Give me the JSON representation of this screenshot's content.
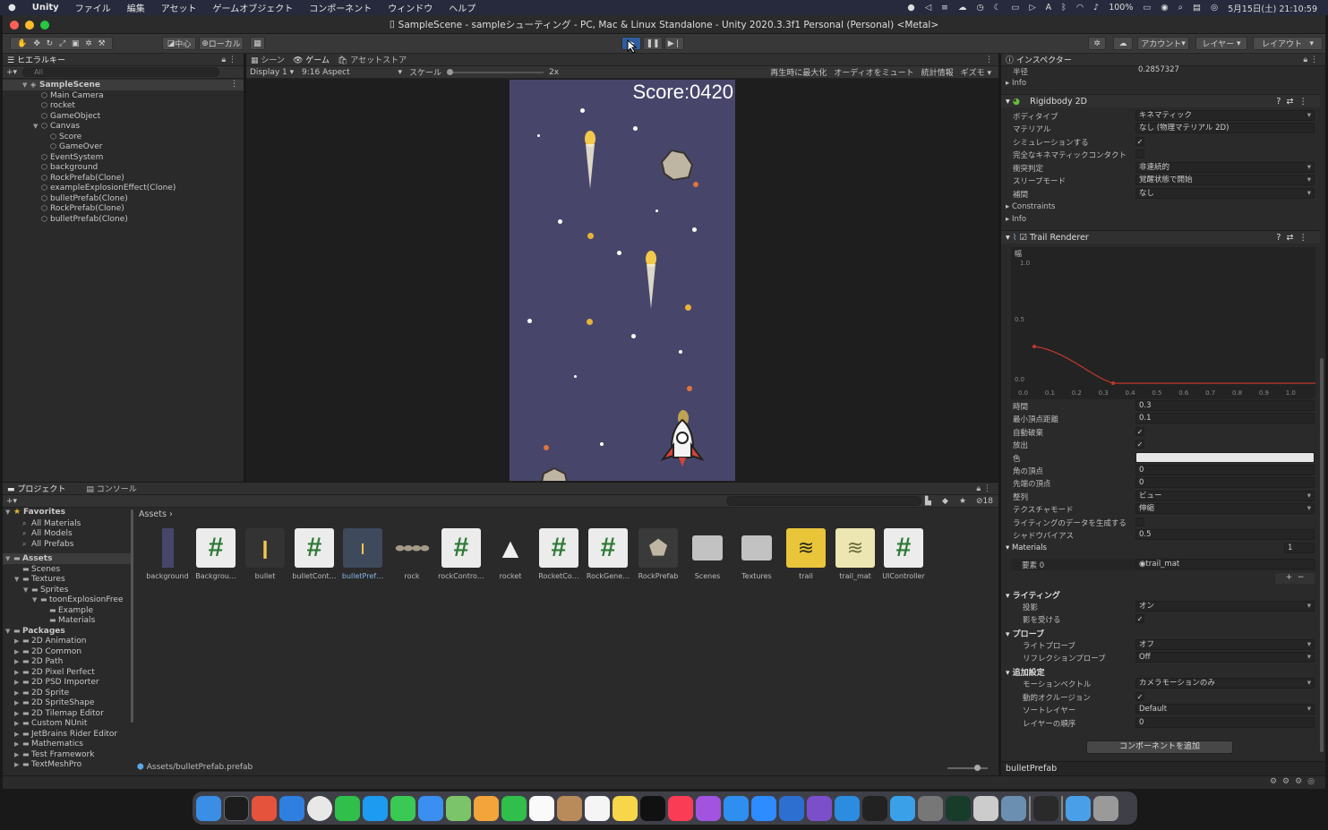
{
  "menubar": {
    "apple": "",
    "app": "Unity",
    "items": [
      "ファイル",
      "編集",
      "アセット",
      "ゲームオブジェクト",
      "コンポーネント",
      "ウィンドウ",
      "ヘルプ"
    ],
    "battery": "100%",
    "datetime": "5月15日(土) 21:10:59"
  },
  "window": {
    "title": "SampleScene - sampleシューティング - PC, Mac & Linux Standalone - Unity 2020.3.3f1 Personal (Personal) <Metal>"
  },
  "toolbar": {
    "pivot": "中心",
    "space": "ローカル",
    "account": "アカウント",
    "layers": "レイヤー",
    "layout": "レイアウト"
  },
  "hierarchy": {
    "tab": "ヒエラルキー",
    "search": "All",
    "scene": "SampleScene",
    "items": [
      "Main Camera",
      "rocket",
      "GameObject",
      "Canvas",
      "Score",
      "GameOver",
      "EventSystem",
      "background",
      "RockPrefab(Clone)",
      "exampleExplosionEffect(Clone)",
      "bulletPrefab(Clone)",
      "RockPrefab(Clone)",
      "bulletPrefab(Clone)"
    ]
  },
  "scenetabs": {
    "scene": "シーン",
    "game": "ゲーム",
    "store": "アセットストア",
    "display": "Display 1",
    "aspect": "9:16 Aspect",
    "scale_label": "スケール",
    "scale_value": "2x",
    "maximize": "再生時に最大化",
    "mute": "オーディオをミュート",
    "stats": "統計情報",
    "gizmos": "ギズモ"
  },
  "game": {
    "score": "Score:0420"
  },
  "project": {
    "tab_project": "プロジェクト",
    "tab_console": "コンソール",
    "breadcrumb": "Assets",
    "hidden_count": "18",
    "status_path": "Assets/bulletPrefab.prefab",
    "favorites": {
      "label": "Favorites",
      "items": [
        "All Materials",
        "All Models",
        "All Prefabs"
      ]
    },
    "assets_tree": [
      "Assets",
      "Scenes",
      "Textures",
      "Sprites",
      "toonExplosionFree",
      "Example",
      "Materials"
    ],
    "packages": {
      "label": "Packages",
      "items": [
        "2D Animation",
        "2D Common",
        "2D Path",
        "2D Pixel Perfect",
        "2D PSD Importer",
        "2D Sprite",
        "2D SpriteShape",
        "2D Tilemap Editor",
        "Custom NUnit",
        "JetBrains Rider Editor",
        "Mathematics",
        "Test Framework",
        "TextMeshPro"
      ]
    },
    "assets": [
      "background",
      "Backgrou…",
      "bullet",
      "bulletCont…",
      "bulletPref…",
      "rock",
      "rockContro…",
      "rocket",
      "RocketCo…",
      "RockGene…",
      "RockPrefab",
      "Scenes",
      "Textures",
      "trail",
      "trail_mat",
      "UIController"
    ]
  },
  "inspector": {
    "tab": "インスペクター",
    "radius_label": "半径",
    "radius_value": "0.2857327",
    "info": "Info",
    "rigidbody": {
      "title": "Rigidbody 2D",
      "rows": [
        [
          "ボディタイプ",
          "キネマティック"
        ],
        [
          "マテリアル",
          "なし (物理マテリアル 2D)"
        ],
        [
          "シミュレーションする",
          "✓"
        ],
        [
          "完全なキネマティックコンタクト",
          ""
        ],
        [
          "衝突判定",
          "非連続的"
        ],
        [
          "スリープモード",
          "覚醒状態で開始"
        ],
        [
          "補間",
          "なし"
        ]
      ],
      "constraints": "Constraints",
      "info": "Info"
    },
    "trail": {
      "title": "Trail Renderer",
      "curve_label": "幅",
      "curve_y": [
        "1.0",
        "0.5",
        "0.0"
      ],
      "curve_x": [
        "0.0",
        "0.1",
        "0.2",
        "0.3",
        "0.4",
        "0.5",
        "0.6",
        "0.7",
        "0.8",
        "0.9",
        "1.0"
      ],
      "rows": [
        [
          "時間",
          "0.3"
        ],
        [
          "最小頂点距離",
          "0.1"
        ],
        [
          "自動破棄",
          "✓"
        ],
        [
          "放出",
          "✓"
        ],
        [
          "色",
          ""
        ],
        [
          "角の頂点",
          "0"
        ],
        [
          "先端の頂点",
          "0"
        ],
        [
          "整列",
          "ビュー"
        ],
        [
          "テクスチャモード",
          "伸縮"
        ],
        [
          "ライティングのデータを生成する",
          ""
        ],
        [
          "シャドウバイアス",
          "0.5"
        ]
      ],
      "materials_label": "Materials",
      "materials_count": "1",
      "element0": "要素 0",
      "element0_value": "trail_mat",
      "lighting": "ライティング",
      "cast": "投影",
      "cast_value": "オン",
      "receive": "影を受ける",
      "receive_value": "✓",
      "probes": "プローブ",
      "light_probes": "ライトプローブ",
      "light_probes_value": "オフ",
      "reflection": "リフレクションプローブ",
      "reflection_value": "Off",
      "additional": "追加設定",
      "motion": "モーションベクトル",
      "motion_value": "カメラモーションのみ",
      "dynamic_occ": "動的オクルージョン",
      "dynamic_occ_value": "✓",
      "sort_layer": "ソートレイヤー",
      "sort_layer_value": "Default",
      "order": "レイヤーの順序",
      "order_value": "0"
    },
    "add_component": "コンポーネントを追加",
    "footer": "bulletPrefab"
  },
  "colors": {
    "accent": "#2e5d9e",
    "game_bg": "#47466a",
    "curve": "#c0392b"
  }
}
